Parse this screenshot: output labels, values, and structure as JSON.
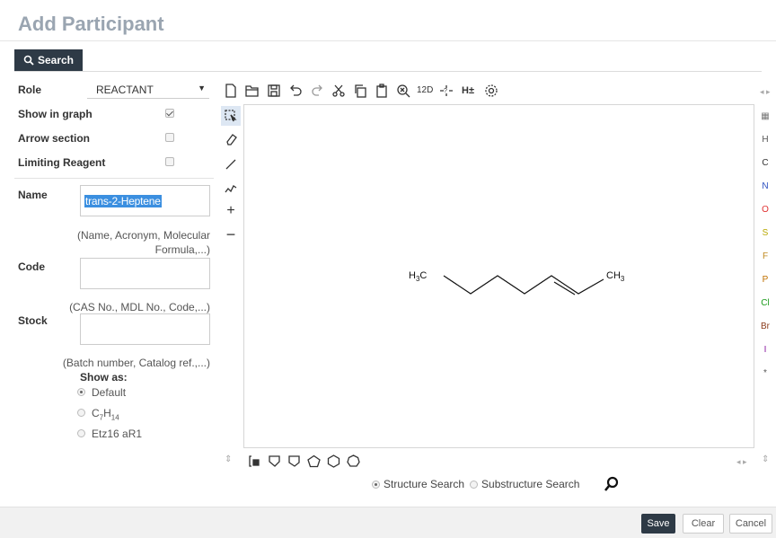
{
  "header": {
    "title": "Add Participant"
  },
  "tab": {
    "search_label": "Search"
  },
  "form": {
    "role_label": "Role",
    "role_value": "REACTANT",
    "show_in_graph_label": "Show in graph",
    "show_in_graph_checked": true,
    "arrow_section_label": "Arrow section",
    "arrow_section_checked": false,
    "limiting_reagent_label": "Limiting Reagent",
    "limiting_reagent_checked": false,
    "name_label": "Name",
    "name_value": "trans-2-Heptene",
    "name_hint_line1": "(Name, Acronym, Molecular",
    "name_hint_line2": "Formula,...)",
    "code_label": "Code",
    "code_value": "",
    "code_hint": "(CAS No., MDL No., Code,...)",
    "stock_label": "Stock",
    "stock_value": "",
    "stock_hint": "(Batch number, Catalog ref.,...)",
    "show_as_label": "Show as:",
    "show_as_options": [
      {
        "label": "Default",
        "selected": true
      },
      {
        "label": "C7H14",
        "selected": false
      },
      {
        "label": "Etz16 aR1",
        "selected": false
      }
    ]
  },
  "editor": {
    "toolbar_text": {
      "twod": "12D",
      "charge": "H±"
    },
    "molecule": {
      "left_group": "H3C",
      "right_group": "CH3"
    },
    "elements": [
      "H",
      "C",
      "N",
      "O",
      "S",
      "F",
      "P",
      "Cl",
      "Br",
      "I",
      "*"
    ],
    "element_colors": {
      "H": "#555555",
      "C": "#333333",
      "N": "#2b4fc0",
      "O": "#e03030",
      "S": "#b8a800",
      "F": "#c08a20",
      "P": "#c07000",
      "Cl": "#1a9a1a",
      "Br": "#8a3a1a",
      "I": "#8a1aa0",
      "*": "#555555"
    }
  },
  "search_modes": {
    "structure": "Structure Search",
    "substructure": "Substructure Search",
    "selected": "structure"
  },
  "footer": {
    "save": "Save",
    "clear": "Clear",
    "cancel": "Cancel"
  }
}
